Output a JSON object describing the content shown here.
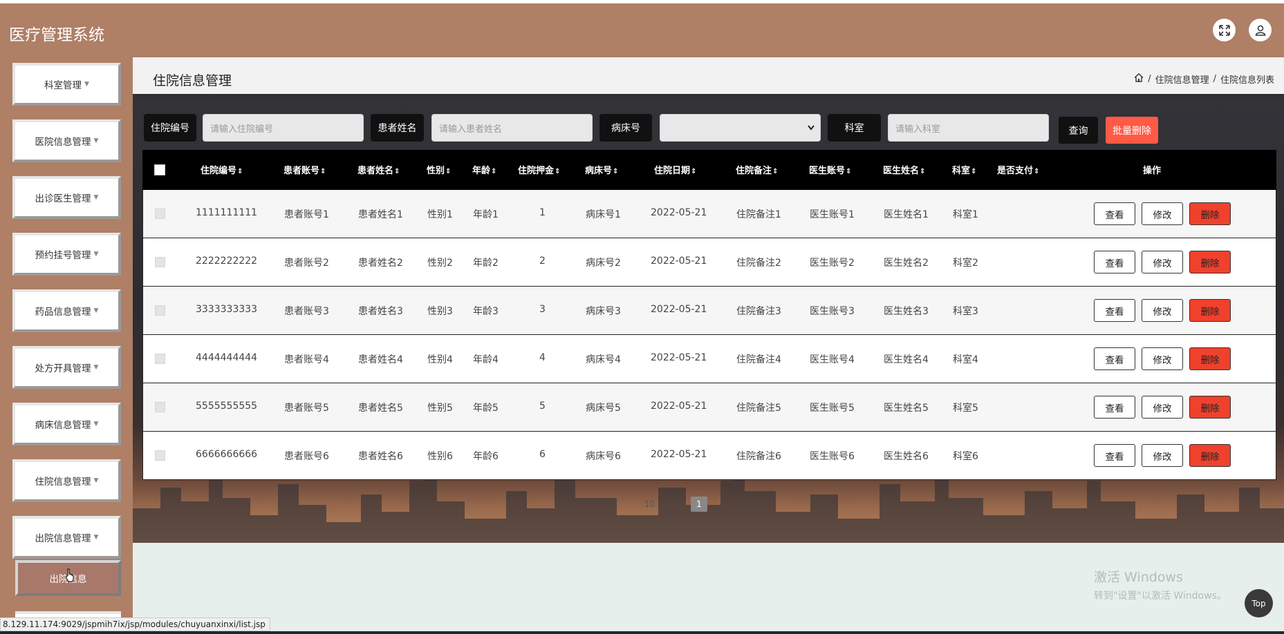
{
  "header": {
    "title": "医疗管理系统",
    "icons": [
      "fullscreen-icon",
      "user-icon"
    ]
  },
  "sidebar": {
    "items": [
      {
        "label": "科室管理"
      },
      {
        "label": "医院信息管理"
      },
      {
        "label": "出诊医生管理"
      },
      {
        "label": "预约挂号管理"
      },
      {
        "label": "药品信息管理"
      },
      {
        "label": "处方开具管理"
      },
      {
        "label": "病床信息管理"
      },
      {
        "label": "住院信息管理"
      },
      {
        "label": "出院信息管理"
      }
    ],
    "active_sub": "出院信息"
  },
  "page": {
    "title": "住院信息管理",
    "breadcrumb": [
      "住院信息管理",
      "住院信息列表"
    ]
  },
  "search": {
    "fields": [
      {
        "label": "住院编号",
        "placeholder": "请输入住院编号"
      },
      {
        "label": "患者姓名",
        "placeholder": "请输入患者姓名"
      },
      {
        "label": "病床号",
        "type": "select",
        "value": ""
      },
      {
        "label": "科室",
        "placeholder": "请输入科室"
      }
    ],
    "query_label": "查询",
    "batch_delete_label": "批量删除"
  },
  "table": {
    "columns": [
      "住院编号",
      "患者账号",
      "患者姓名",
      "性别",
      "年龄",
      "住院押金",
      "病床号",
      "住院日期",
      "住院备注",
      "医生账号",
      "医生姓名",
      "科室",
      "是否支付",
      "操作"
    ],
    "rows": [
      [
        "1111111111",
        "患者账号1",
        "患者姓名1",
        "性别1",
        "年龄1",
        "1",
        "病床号1",
        "2022-05-21",
        "住院备注1",
        "医生账号1",
        "医生姓名1",
        "科室1",
        ""
      ],
      [
        "2222222222",
        "患者账号2",
        "患者姓名2",
        "性别2",
        "年龄2",
        "2",
        "病床号2",
        "2022-05-21",
        "住院备注2",
        "医生账号2",
        "医生姓名2",
        "科室2",
        ""
      ],
      [
        "3333333333",
        "患者账号3",
        "患者姓名3",
        "性别3",
        "年龄3",
        "3",
        "病床号3",
        "2022-05-21",
        "住院备注3",
        "医生账号3",
        "医生姓名3",
        "科室3",
        ""
      ],
      [
        "4444444444",
        "患者账号4",
        "患者姓名4",
        "性别4",
        "年龄4",
        "4",
        "病床号4",
        "2022-05-21",
        "住院备注4",
        "医生账号4",
        "医生姓名4",
        "科室4",
        ""
      ],
      [
        "5555555555",
        "患者账号5",
        "患者姓名5",
        "性别5",
        "年龄5",
        "5",
        "病床号5",
        "2022-05-21",
        "住院备注5",
        "医生账号5",
        "医生姓名5",
        "科室5",
        ""
      ],
      [
        "6666666666",
        "患者账号6",
        "患者姓名6",
        "性别6",
        "年龄6",
        "6",
        "病床号6",
        "2022-05-21",
        "住院备注6",
        "医生账号6",
        "医生姓名6",
        "科室6",
        ""
      ]
    ],
    "actions": {
      "view": "查看",
      "edit": "修改",
      "delete": "删除"
    }
  },
  "pagination": {
    "page_size": "10",
    "current_page": "1"
  },
  "watermark": {
    "line1": "激活 Windows",
    "line2": "转到\"设置\"以激活 Windows。"
  },
  "top_button": "Top",
  "status_url": "8.129.11.174:9029/jspmih7ix/jsp/modules/chuyuanxinxi/list.jsp",
  "colors": {
    "header_bg": "#af7f66",
    "accent_red": "#f0412d",
    "table_head": "#000000"
  }
}
